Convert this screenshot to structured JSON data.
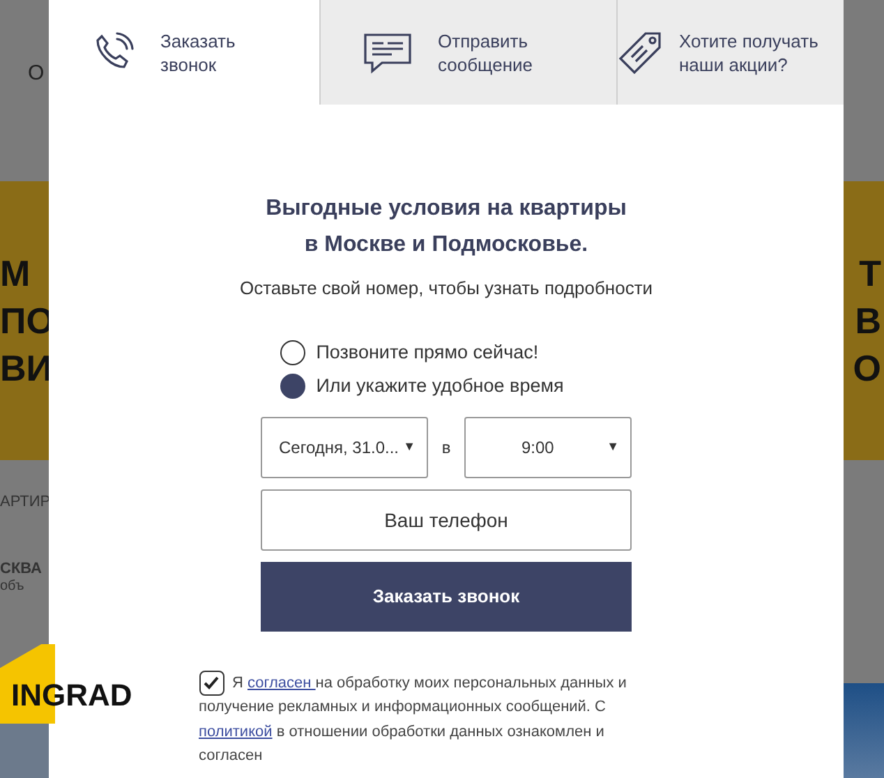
{
  "background": {
    "nav_text": "О",
    "banner_left": [
      "М",
      "ПО",
      "ВИ"
    ],
    "banner_right": [
      "Т",
      "В",
      "О"
    ],
    "menu_left": "АРТИР",
    "city": "СКВА",
    "city_sub": "объ",
    "logo": "INGRAD"
  },
  "modal": {
    "tabs": [
      {
        "label_lines": [
          "Заказать",
          "звонок"
        ],
        "selected": true
      },
      {
        "label_lines": [
          "Отправить",
          "сообщение"
        ],
        "selected": false
      },
      {
        "label_lines": [
          "Хотите получать",
          "наши акции?"
        ],
        "selected": false
      }
    ],
    "title_lines": [
      "Выгодные условия на квартиры",
      "в Москве и Подмосковье."
    ],
    "subtitle": "Оставьте свой номер, чтобы узнать подробности",
    "options": [
      {
        "label": "Позвоните прямо сейчас!",
        "selected": false
      },
      {
        "label": "Или укажите удобное время",
        "selected": true
      }
    ],
    "date": {
      "value": "Сегодня, 31.0...",
      "caret": "▼"
    },
    "connector": "в",
    "time": {
      "value": "9:00",
      "caret": "▼"
    },
    "phone": {
      "placeholder": "Ваш телефон"
    },
    "submit": "Заказать звонок",
    "consent": {
      "checked": true,
      "parts": [
        {
          "kind": "text",
          "text": "Я "
        },
        {
          "kind": "link",
          "text": "согласен "
        },
        {
          "kind": "text",
          "text": " на обработку моих персональных данных и получение рекламных и информационных сообщений. С "
        },
        {
          "kind": "link",
          "text": "политикой"
        },
        {
          "kind": "text",
          "text": " в отношении обработки данных ознакомлен и согласен"
        }
      ]
    }
  }
}
